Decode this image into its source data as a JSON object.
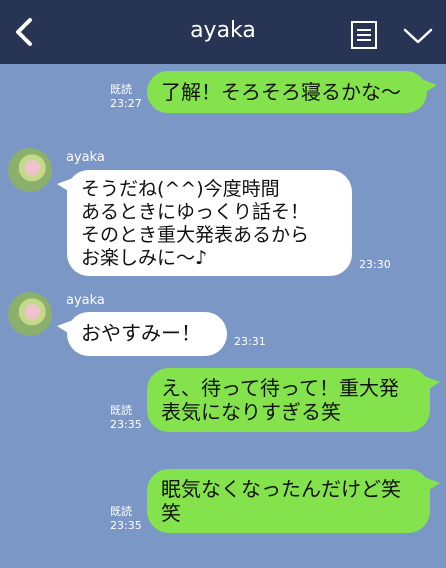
{
  "header": {
    "title": "ayaka",
    "back_icon": "chevron-left-icon",
    "menu_icon": "note-icon",
    "collapse_icon": "chevron-down-icon"
  },
  "colors": {
    "header_bg": "#283453",
    "chat_bg": "#7b97c6",
    "sent_bubble": "#84e34c",
    "received_bubble": "#ffffff"
  },
  "messages": [
    {
      "sender": "me",
      "text": "了解！そろそろ寝るかな〜",
      "read": "既読",
      "time": "23:27"
    },
    {
      "sender": "ayaka",
      "name": "ayaka",
      "text": "そうだね(^^)今度時間\nあるときにゆっくり話そ！\nそのとき重大発表あるから\nお楽しみに〜♪",
      "time": "23:30"
    },
    {
      "sender": "ayaka",
      "name": "ayaka",
      "text": "おやすみー！",
      "time": "23:31"
    },
    {
      "sender": "me",
      "text": "え、待って待って！重大発\n表気になりすぎる笑",
      "read": "既読",
      "time": "23:35"
    },
    {
      "sender": "me",
      "text": "眠気なくなったんだけど笑\n笑",
      "read": "既読",
      "time": "23:35"
    }
  ]
}
